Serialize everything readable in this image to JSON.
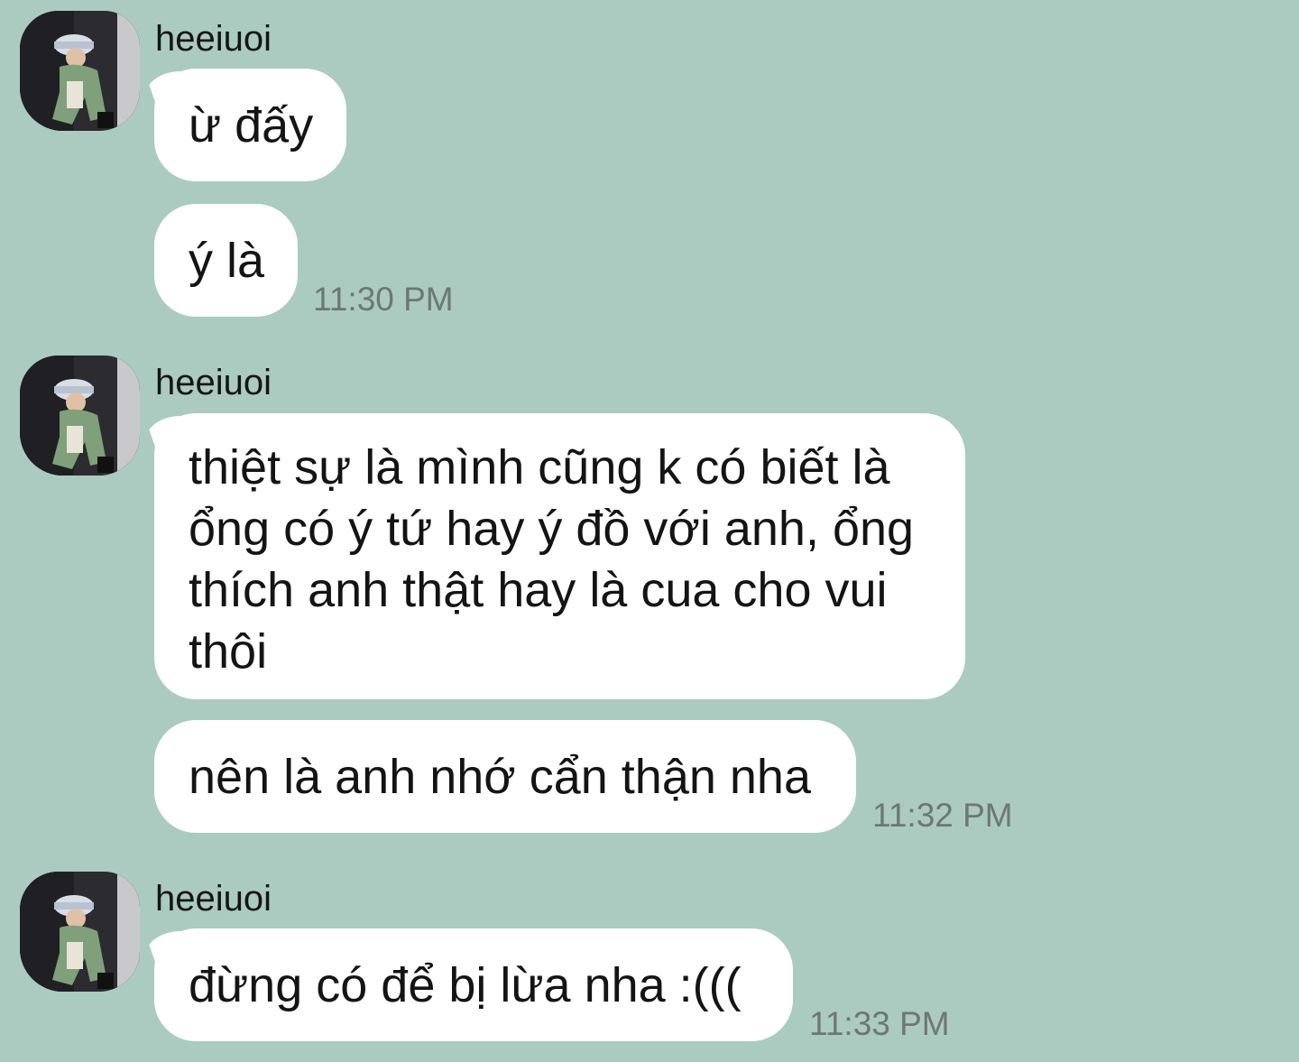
{
  "messages": [
    {
      "sender": "heeiuoi",
      "avatar": "avatar-photo",
      "bubbles": [
        "ừ đấy",
        "ý là"
      ],
      "time": "11:30 PM"
    },
    {
      "sender": "heeiuoi",
      "avatar": "avatar-photo",
      "bubbles": [
        "thiệt sự là mình cũng k có biết là ổng có ý tứ hay ý đồ với anh, ổng thích anh thật hay là cua cho vui thôi",
        "nên là anh nhớ cẩn thận nha"
      ],
      "time": "11:32 PM"
    },
    {
      "sender": "heeiuoi",
      "avatar": "avatar-photo",
      "bubbles": [
        "đừng có để bị lừa nha :((("
      ],
      "time": "11:33 PM"
    }
  ],
  "colors": {
    "background": "#abcbc0",
    "bubble": "#ffffff",
    "text": "#141414",
    "timestamp": "#6d7773"
  }
}
